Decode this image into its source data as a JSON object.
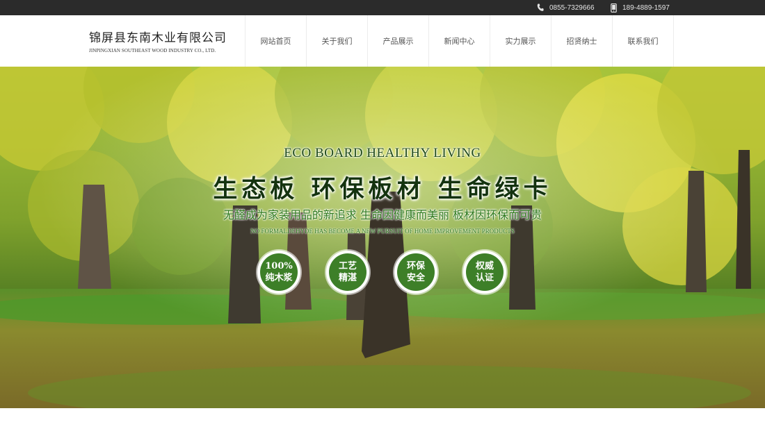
{
  "topbar": {
    "phone": {
      "icon": "phone-icon",
      "text": "0855-7329666"
    },
    "mobile": {
      "icon": "mobile-icon",
      "text": "189-4889-1597"
    }
  },
  "header": {
    "company_name": "锦屏县东南木业有限公司",
    "company_name_en": "JINPINGXIAN SOUTHEAST WOOD INDUSTRY CO., LTD."
  },
  "nav": {
    "items": [
      {
        "label": "网站首页"
      },
      {
        "label": "关于我们"
      },
      {
        "label": "产品展示"
      },
      {
        "label": "新闻中心"
      },
      {
        "label": "实力展示"
      },
      {
        "label": "招贤纳士"
      },
      {
        "label": "联系我们"
      }
    ]
  },
  "hero": {
    "slogan_en": "ECO BOARD HEALTHY LIVING",
    "slogan_cn": "生态板  环保板材  生命绿卡",
    "subtitle": "无醛成为家装用品的新追求 生命因健康而美丽 板材因环保而可贵",
    "subtitle_en": "NO FORMALDEHYDE HAS BECOME A NEW PURSUIT OF HOME IMPROVEMENT PRODUCTS",
    "badges": [
      {
        "line1": "100%",
        "line2": "纯木浆"
      },
      {
        "line1": "工艺",
        "line2": "精湛"
      },
      {
        "line1": "环保",
        "line2": "安全"
      },
      {
        "line1": "权威",
        "line2": "认证"
      }
    ]
  },
  "colors": {
    "topbar_bg": "#2b2b2b",
    "badge_green": "#3d7f28",
    "slogan_dark_green": "#14330f",
    "subtitle_green": "#2f7a1d"
  }
}
